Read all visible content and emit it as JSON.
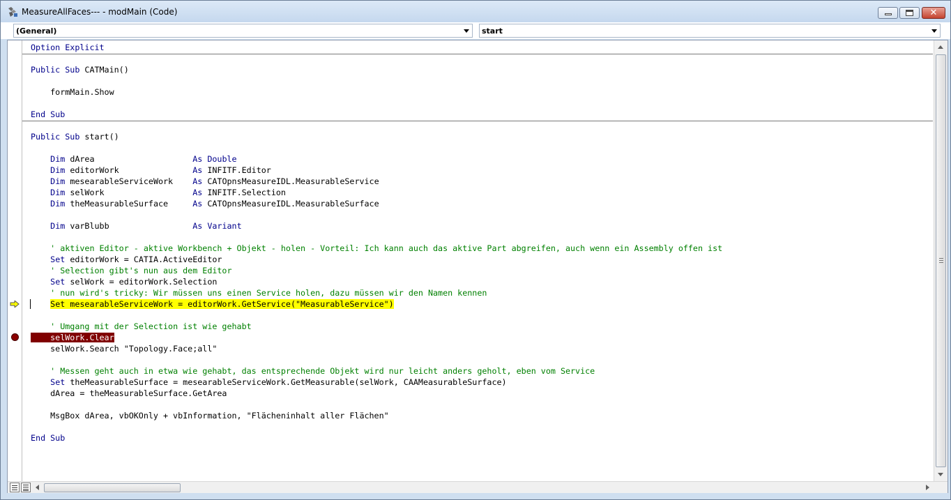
{
  "window": {
    "title": "MeasureAllFaces--- - modMain (Code)",
    "icons": {
      "app": "vba-module-icon",
      "minimize": "minimize-icon",
      "maximize": "maximize-icon",
      "close": "close-icon"
    },
    "close_glyph": "✕"
  },
  "combos": {
    "object": "(General)",
    "procedure": "start"
  },
  "colors": {
    "keyword": "#00008b",
    "comment": "#008000",
    "exec_highlight": "#ffff00",
    "breakpoint_highlight": "#800000"
  },
  "code": {
    "lines": [
      [
        {
          "k": "kw",
          "t": "Option Explicit"
        }
      ],
      [],
      [
        {
          "k": "kw",
          "t": "Public Sub"
        },
        {
          "k": "tx",
          "t": " CATMain()"
        }
      ],
      [],
      [
        {
          "k": "tx",
          "t": "    formMain.Show"
        }
      ],
      [],
      [
        {
          "k": "kw",
          "t": "End Sub"
        }
      ],
      [],
      [
        {
          "k": "kw",
          "t": "Public Sub"
        },
        {
          "k": "tx",
          "t": " start()"
        }
      ],
      [],
      [
        {
          "k": "tx",
          "t": "    "
        },
        {
          "k": "kw",
          "t": "Dim"
        },
        {
          "k": "tx",
          "t": " dArea                    "
        },
        {
          "k": "kw",
          "t": "As"
        },
        {
          "k": "tx",
          "t": " "
        },
        {
          "k": "kw",
          "t": "Double"
        }
      ],
      [
        {
          "k": "tx",
          "t": "    "
        },
        {
          "k": "kw",
          "t": "Dim"
        },
        {
          "k": "tx",
          "t": " editorWork               "
        },
        {
          "k": "kw",
          "t": "As"
        },
        {
          "k": "tx",
          "t": " INFITF.Editor"
        }
      ],
      [
        {
          "k": "tx",
          "t": "    "
        },
        {
          "k": "kw",
          "t": "Dim"
        },
        {
          "k": "tx",
          "t": " mesearableServiceWork    "
        },
        {
          "k": "kw",
          "t": "As"
        },
        {
          "k": "tx",
          "t": " CATOpnsMeasureIDL.MeasurableService"
        }
      ],
      [
        {
          "k": "tx",
          "t": "    "
        },
        {
          "k": "kw",
          "t": "Dim"
        },
        {
          "k": "tx",
          "t": " selWork                  "
        },
        {
          "k": "kw",
          "t": "As"
        },
        {
          "k": "tx",
          "t": " INFITF.Selection"
        }
      ],
      [
        {
          "k": "tx",
          "t": "    "
        },
        {
          "k": "kw",
          "t": "Dim"
        },
        {
          "k": "tx",
          "t": " theMeasurableSurface     "
        },
        {
          "k": "kw",
          "t": "As"
        },
        {
          "k": "tx",
          "t": " CATOpnsMeasureIDL.MeasurableSurface"
        }
      ],
      [],
      [
        {
          "k": "tx",
          "t": "    "
        },
        {
          "k": "kw",
          "t": "Dim"
        },
        {
          "k": "tx",
          "t": " varBlubb                 "
        },
        {
          "k": "kw",
          "t": "As"
        },
        {
          "k": "tx",
          "t": " "
        },
        {
          "k": "kw",
          "t": "Variant"
        }
      ],
      [],
      [
        {
          "k": "tx",
          "t": "    "
        },
        {
          "k": "cm",
          "t": "' aktiven Editor - aktive Workbench + Objekt - holen - Vorteil: Ich kann auch das aktive Part abgreifen, auch wenn ein Assembly offen ist"
        }
      ],
      [
        {
          "k": "tx",
          "t": "    "
        },
        {
          "k": "kw",
          "t": "Set"
        },
        {
          "k": "tx",
          "t": " editorWork = CATIA.ActiveEditor"
        }
      ],
      [
        {
          "k": "tx",
          "t": "    "
        },
        {
          "k": "cm",
          "t": "' Selection gibt's nun aus dem Editor"
        }
      ],
      [
        {
          "k": "tx",
          "t": "    "
        },
        {
          "k": "kw",
          "t": "Set"
        },
        {
          "k": "tx",
          "t": " selWork = editorWork.Selection"
        }
      ],
      [
        {
          "k": "tx",
          "t": "    "
        },
        {
          "k": "cm",
          "t": "' nun wird's tricky: Wir müssen uns einen Service holen, dazu müssen wir den Namen kennen"
        }
      ],
      [
        {
          "k": "tx",
          "t": "    "
        },
        {
          "k": "exec",
          "t": "Set mesearableServiceWork = editorWork.GetService(\"MeasurableService\")"
        }
      ],
      [],
      [
        {
          "k": "tx",
          "t": "    "
        },
        {
          "k": "cm",
          "t": "' Umgang mit der Selection ist wie gehabt"
        }
      ],
      [
        {
          "k": "bp",
          "t": "    selWork.Clear"
        }
      ],
      [
        {
          "k": "tx",
          "t": "    selWork.Search \"Topology.Face;all\""
        }
      ],
      [],
      [
        {
          "k": "tx",
          "t": "    "
        },
        {
          "k": "cm",
          "t": "' Messen geht auch in etwa wie gehabt, das entsprechende Objekt wird nur leicht anders geholt, eben vom Service"
        }
      ],
      [
        {
          "k": "tx",
          "t": "    "
        },
        {
          "k": "kw",
          "t": "Set"
        },
        {
          "k": "tx",
          "t": " theMeasurableSurface = mesearableServiceWork.GetMeasurable(selWork, CAAMeasurableSurface)"
        }
      ],
      [
        {
          "k": "tx",
          "t": "    dArea = theMeasurableSurface.GetArea"
        }
      ],
      [],
      [
        {
          "k": "tx",
          "t": "    MsgBox dArea, vbOKOnly + vbInformation, \"Flächeninhalt aller Flächen\""
        }
      ],
      [],
      [
        {
          "k": "kw",
          "t": "End Sub"
        }
      ]
    ],
    "current_line_index": 23,
    "breakpoint_line_index": 26,
    "separator_after_lines": [
      0,
      6
    ]
  },
  "markers": {
    "exec_arrow": "execution-pointer-arrow-icon",
    "breakpoint": "breakpoint-dot-icon"
  }
}
